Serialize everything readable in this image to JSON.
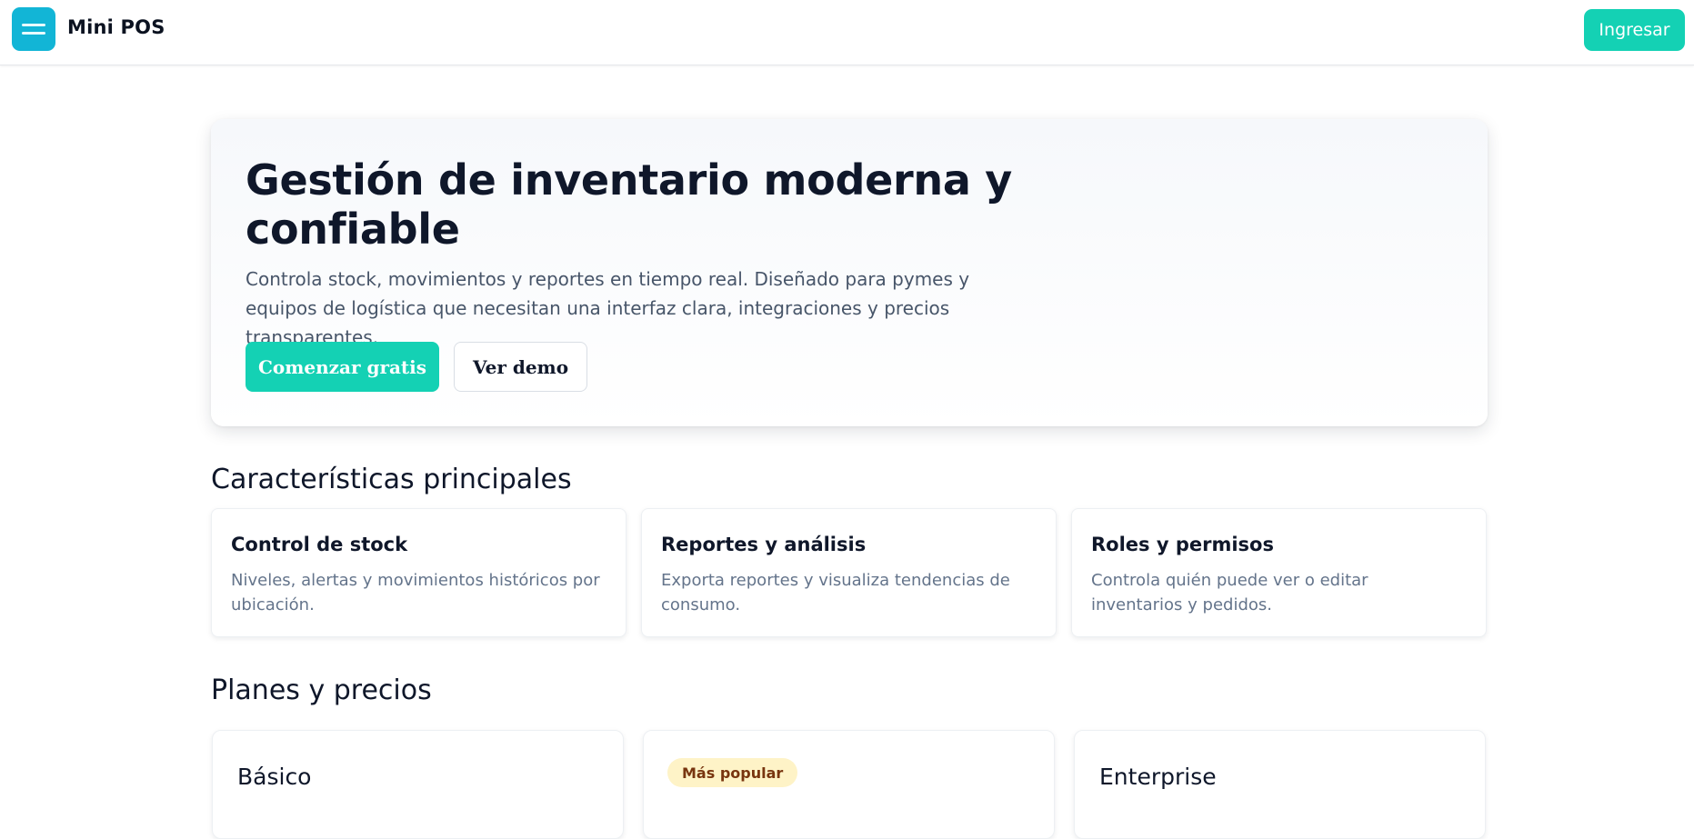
{
  "header": {
    "brand": "Mini POS",
    "menu_icon": "hamburger-menu-icon",
    "login_label": "Ingresar"
  },
  "hero": {
    "title": "Gestión de inventario moderna y confiable",
    "description": "Controla stock, movimientos y reportes en tiempo real. Diseñado para pymes y equipos de logística que necesitan una interfaz clara, integraciones y precios transparentes.",
    "primary_cta": "Comenzar gratis",
    "secondary_cta": "Ver demo"
  },
  "features": {
    "title": "Características principales",
    "items": [
      {
        "title": "Control de stock",
        "description": "Niveles, alertas y movimientos históricos por ubicación."
      },
      {
        "title": "Reportes y análisis",
        "description": "Exporta reportes y visualiza tendencias de consumo."
      },
      {
        "title": "Roles y permisos",
        "description": "Controla quién puede ver o editar inventarios y pedidos."
      }
    ]
  },
  "plans": {
    "title": "Planes y precios",
    "items": [
      {
        "name": "Básico"
      },
      {
        "badge": "Más popular"
      },
      {
        "name": "Enterprise"
      }
    ]
  },
  "colors": {
    "accent": "#14d1b4",
    "menu_button": "#12b5d6",
    "badge_bg": "#fef3c7",
    "badge_text": "#78350f"
  }
}
